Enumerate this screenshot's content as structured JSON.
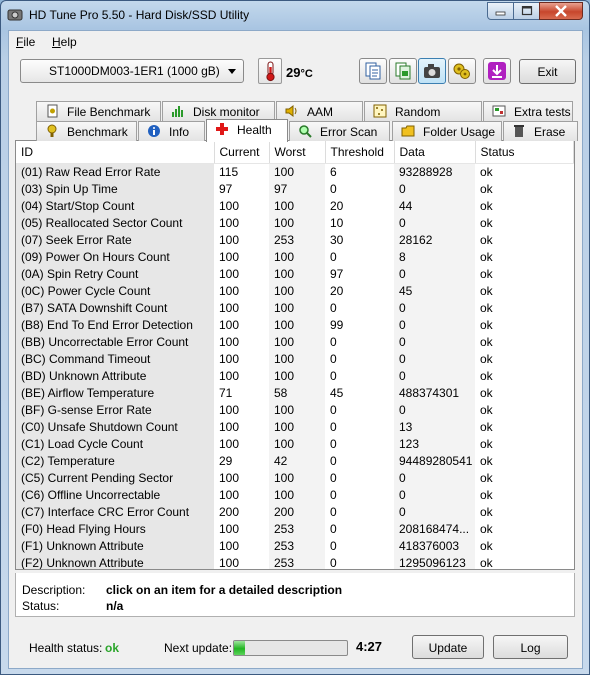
{
  "window": {
    "title": "HD Tune Pro 5.50 - Hard Disk/SSD Utility"
  },
  "menu": [
    {
      "label": "File",
      "accel": "F"
    },
    {
      "label": "Help",
      "accel": "H"
    }
  ],
  "toolbar": {
    "drive": "ST1000DM003-1ER1 (1000 gB)",
    "temperature": "29",
    "temperature_unit": "°C",
    "exit_label": "Exit"
  },
  "tabs_top": [
    "File Benchmark",
    "Disk monitor",
    "AAM",
    "Random Access",
    "Extra tests"
  ],
  "tabs_bottom": [
    "Benchmark",
    "Info",
    "Health",
    "Error Scan",
    "Folder Usage",
    "Erase"
  ],
  "selected_tab": "Health",
  "table": {
    "columns": [
      "ID",
      "Current",
      "Worst",
      "Threshold",
      "Data",
      "Status"
    ],
    "rows": [
      [
        "(01) Raw Read Error Rate",
        "115",
        "100",
        "6",
        "93288928",
        "ok"
      ],
      [
        "(03) Spin Up Time",
        "97",
        "97",
        "0",
        "0",
        "ok"
      ],
      [
        "(04) Start/Stop Count",
        "100",
        "100",
        "20",
        "44",
        "ok"
      ],
      [
        "(05) Reallocated Sector Count",
        "100",
        "100",
        "10",
        "0",
        "ok"
      ],
      [
        "(07) Seek Error Rate",
        "100",
        "253",
        "30",
        "28162",
        "ok"
      ],
      [
        "(09) Power On Hours Count",
        "100",
        "100",
        "0",
        "8",
        "ok"
      ],
      [
        "(0A) Spin Retry Count",
        "100",
        "100",
        "97",
        "0",
        "ok"
      ],
      [
        "(0C) Power Cycle Count",
        "100",
        "100",
        "20",
        "45",
        "ok"
      ],
      [
        "(B7) SATA Downshift Count",
        "100",
        "100",
        "0",
        "0",
        "ok"
      ],
      [
        "(B8) End To End Error Detection",
        "100",
        "100",
        "99",
        "0",
        "ok"
      ],
      [
        "(BB) Uncorrectable Error Count",
        "100",
        "100",
        "0",
        "0",
        "ok"
      ],
      [
        "(BC) Command Timeout",
        "100",
        "100",
        "0",
        "0",
        "ok"
      ],
      [
        "(BD) Unknown Attribute",
        "100",
        "100",
        "0",
        "0",
        "ok"
      ],
      [
        "(BE) Airflow Temperature",
        "71",
        "58",
        "45",
        "488374301",
        "ok"
      ],
      [
        "(BF) G-sense Error Rate",
        "100",
        "100",
        "0",
        "0",
        "ok"
      ],
      [
        "(C0) Unsafe Shutdown Count",
        "100",
        "100",
        "0",
        "13",
        "ok"
      ],
      [
        "(C1) Load Cycle Count",
        "100",
        "100",
        "0",
        "123",
        "ok"
      ],
      [
        "(C2) Temperature",
        "29",
        "42",
        "0",
        "94489280541",
        "ok"
      ],
      [
        "(C5) Current Pending Sector",
        "100",
        "100",
        "0",
        "0",
        "ok"
      ],
      [
        "(C6) Offline Uncorrectable",
        "100",
        "100",
        "0",
        "0",
        "ok"
      ],
      [
        "(C7) Interface CRC Error Count",
        "200",
        "200",
        "0",
        "0",
        "ok"
      ],
      [
        "(F0) Head Flying Hours",
        "100",
        "253",
        "0",
        "208168474...",
        "ok"
      ],
      [
        "(F1) Unknown Attribute",
        "100",
        "253",
        "0",
        "418376003",
        "ok"
      ],
      [
        "(F2) Unknown Attribute",
        "100",
        "253",
        "0",
        "1295096123",
        "ok"
      ]
    ]
  },
  "description": {
    "desc_label": "Description:",
    "desc_value": "click on an item for a detailed description",
    "status_label": "Status:",
    "status_value": "n/a"
  },
  "footer": {
    "health_label": "Health status:",
    "health_value": "ok",
    "next_update_label": "Next update:",
    "progress_fraction": 0.1,
    "countdown": "4:27",
    "update_label": "Update",
    "log_label": "Log"
  },
  "colors": {
    "ok_green": "#2aa52a",
    "close_red": "#c7462c",
    "progress_green": "#22b522"
  }
}
